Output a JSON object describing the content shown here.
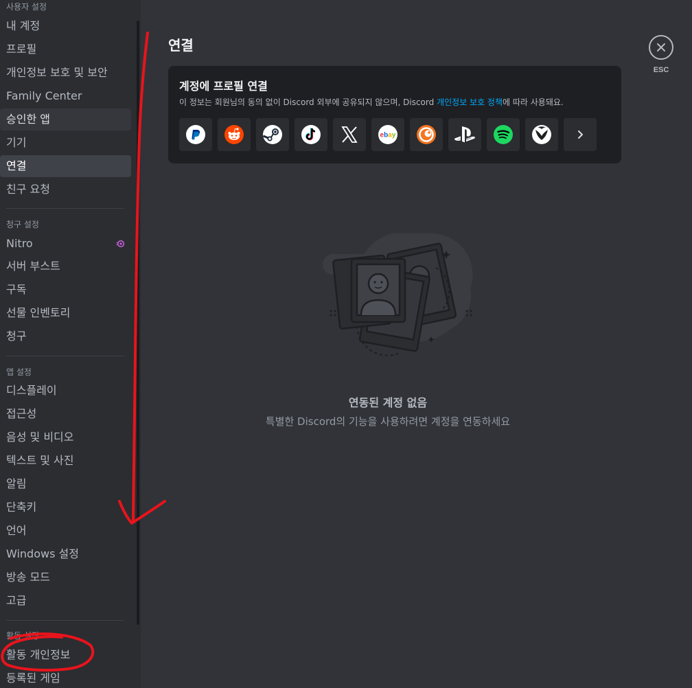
{
  "sidebar": {
    "sections": {
      "user": "사용자 설정",
      "billing": "청구 설정",
      "app": "앱 설정",
      "activity": "활동 설정"
    },
    "items": {
      "my_account": "내 계정",
      "profile": "프로필",
      "privacy": "개인정보 보호 및 보안",
      "family": "Family Center",
      "authorized_apps": "승인한 앱",
      "devices": "기기",
      "connections": "연결",
      "friend_requests": "친구 요청",
      "nitro": "Nitro",
      "server_boost": "서버 부스트",
      "subscriptions": "구독",
      "gift_inventory": "선물 인벤토리",
      "billing": "청구",
      "appearance": "디스플레이",
      "accessibility": "접근성",
      "voice_video": "음성 및 비디오",
      "text_images": "텍스트 및 사진",
      "notifications": "알림",
      "keybinds": "단축키",
      "language": "언어",
      "windows": "Windows 설정",
      "streamer": "방송 모드",
      "advanced": "고급",
      "activity_privacy": "활동 개인정보",
      "registered_games": "등록된 게임"
    }
  },
  "main": {
    "title": "연결",
    "esc": "ESC",
    "card": {
      "title": "계정에 프로필 연결",
      "desc_pre": "이 정보는 회원님의 동의 없이 Discord 외부에 공유되지 않으며, Discord ",
      "desc_link": "개인정보 보호 정책",
      "desc_post": "에 따라 사용돼요.",
      "services": [
        "paypal",
        "reddit",
        "steam",
        "tiktok",
        "x",
        "ebay",
        "crunchyroll",
        "playstation",
        "spotify",
        "xbox",
        "more"
      ]
    },
    "empty": {
      "title": "연동된 계정 없음",
      "desc": "특별한 Discord의 기능을 사용하려면 계정을 연동하세요"
    }
  },
  "colors": {
    "accent_link": "#00a8fc",
    "annotation_red": "#e8141c",
    "nitro_pink": "#c65fd9"
  }
}
